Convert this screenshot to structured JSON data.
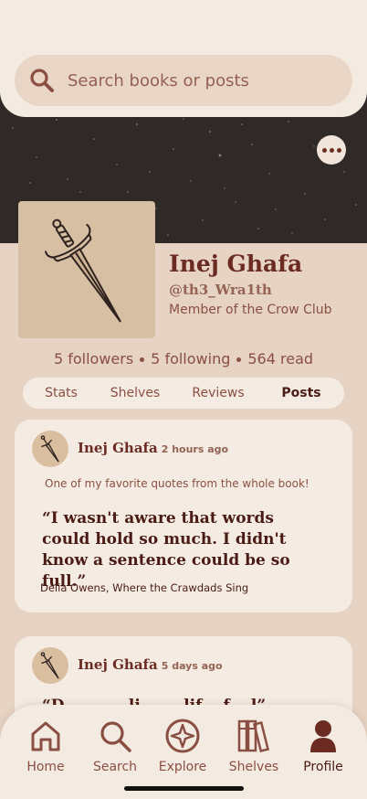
{
  "search": {
    "placeholder": "Search books or posts"
  },
  "profile": {
    "name": "Inej Ghafa",
    "handle": "@th3_Wra1th",
    "member_text": "Member of the Crow Club"
  },
  "stats": {
    "followers": "5 followers",
    "following": "5 following",
    "read": "564 read"
  },
  "tabs": [
    {
      "label": "Stats",
      "active": false
    },
    {
      "label": "Shelves",
      "active": false
    },
    {
      "label": "Reviews",
      "active": false
    },
    {
      "label": "Posts",
      "active": true
    }
  ],
  "posts": [
    {
      "author": "Inej Ghafa",
      "time": "2 hours ago",
      "caption": "One of my favorite quotes from the whole book!",
      "quote": "“I wasn't aware that words could hold so much. I didn't know a sentence could be so full.”",
      "source": "Delia Owens, Where the Crawdads Sing"
    },
    {
      "author": "Inej Ghafa",
      "time": "5 days ago",
      "quote_partial": "“D... ... ... li... ... lif... f... l”"
    }
  ],
  "nav": [
    {
      "label": "Home",
      "icon": "home-icon"
    },
    {
      "label": "Search",
      "icon": "search-icon"
    },
    {
      "label": "Explore",
      "icon": "compass-icon"
    },
    {
      "label": "Shelves",
      "icon": "books-icon"
    },
    {
      "label": "Profile",
      "icon": "person-icon",
      "active": true
    }
  ],
  "colors": {
    "accent": "#6b2b22",
    "background": "#e6d3c3",
    "card": "#f4ece3",
    "banner": "#2f2a28"
  }
}
